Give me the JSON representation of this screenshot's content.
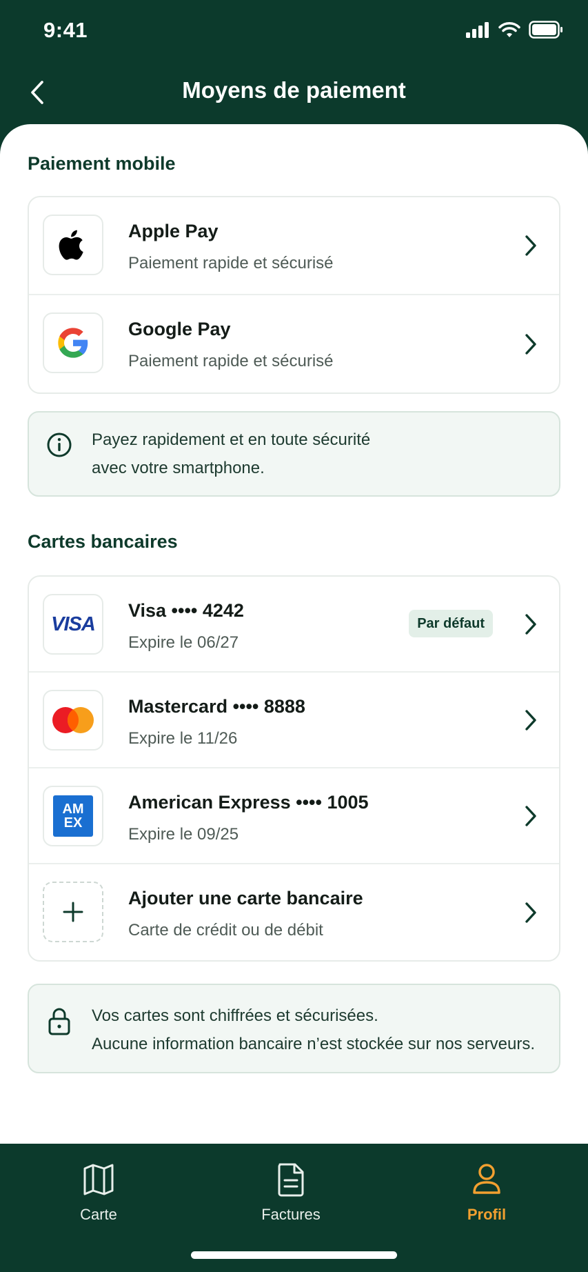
{
  "status_bar": {
    "time": "9:41"
  },
  "header": {
    "title": "Moyens de paiement"
  },
  "mobile_section": {
    "title": "Paiement mobile",
    "items": [
      {
        "title": "Apple Pay",
        "subtitle": "Paiement rapide et sécurisé",
        "icon": "apple-icon"
      },
      {
        "title": "Google Pay",
        "subtitle": "Paiement rapide et sécurisé",
        "icon": "google-icon"
      }
    ],
    "info_line1": "Payez rapidement et en toute sécurité",
    "info_line2": "avec votre smartphone."
  },
  "cards_section": {
    "title": "Cartes bancaires",
    "cards": [
      {
        "title": "Visa •••• 4242",
        "subtitle": "Expire le 06/27",
        "logo": "VISA",
        "badge": "Par défaut"
      },
      {
        "title": "Mastercard •••• 8888",
        "subtitle": "Expire le 11/26",
        "logo": "mastercard-logo"
      },
      {
        "title": "American Express •••• 1005",
        "subtitle": "Expire le 09/25",
        "logo_line1": "AM",
        "logo_line2": "EX"
      }
    ],
    "add_card": {
      "title": "Ajouter une carte bancaire",
      "subtitle": "Carte de crédit ou de débit"
    },
    "security_line1": "Vos cartes sont chiffrées et sécurisées.",
    "security_line2": "Aucune information bancaire n’est stockée sur nos serveurs."
  },
  "tabs": [
    {
      "label": "Carte",
      "icon": "map-icon",
      "active": false
    },
    {
      "label": "Factures",
      "icon": "document-icon",
      "active": false
    },
    {
      "label": "Profil",
      "icon": "user-icon",
      "active": true
    }
  ],
  "colors": {
    "primary": "#0c3a2c",
    "accent": "#f2a030",
    "info_bg": "#f2f7f4",
    "badge_bg": "#e3efe8",
    "visa_blue": "#1a3d9e",
    "amex_blue": "#1a6fd1",
    "mastercard_red": "#eb1c24",
    "mastercard_orange": "#f79e1b"
  }
}
